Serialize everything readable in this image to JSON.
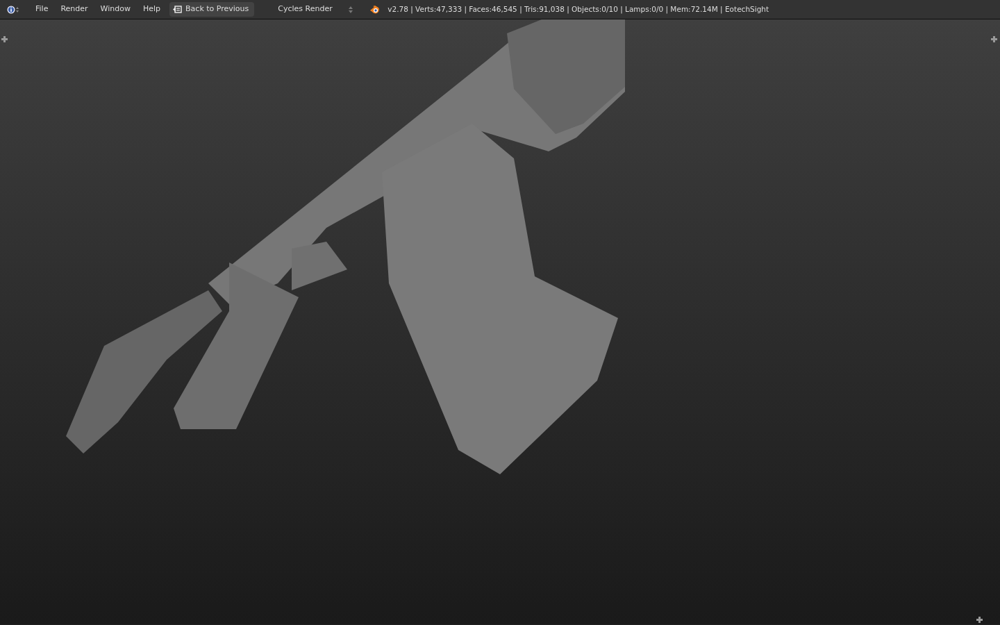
{
  "header": {
    "menus": [
      "File",
      "Render",
      "Window",
      "Help"
    ],
    "back_button": "Back to Previous",
    "render_engine": "Cycles Render",
    "stats": "v2.78 | Verts:47,333 | Faces:46,545 | Tris:91,038 | Objects:0/10 | Lamps:0/0 | Mem:72.14M | EotechSight"
  }
}
